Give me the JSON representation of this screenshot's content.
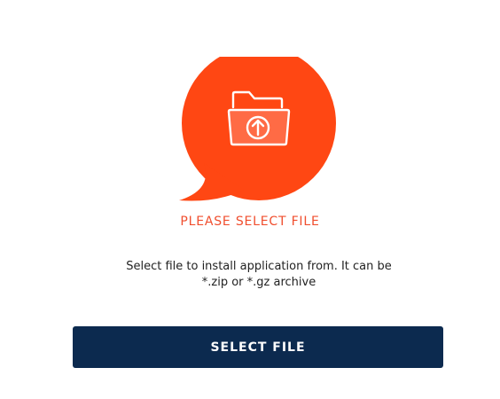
{
  "upload": {
    "title": "PLEASE SELECT FILE",
    "description": "Select file to install application from. It can be *.zip or *.gz archive",
    "button_label": "SELECT FILE",
    "icon": "folder-upload-icon"
  },
  "colors": {
    "accent": "#ff4713",
    "title_text": "#f04e2e",
    "button_bg": "#0c2a4f",
    "button_text": "#ffffff",
    "body_text": "#222222"
  }
}
